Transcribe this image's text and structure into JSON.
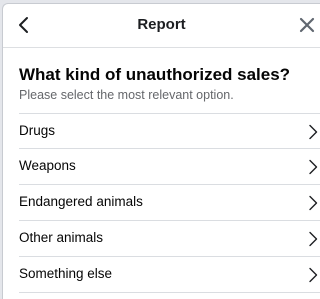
{
  "header": {
    "title": "Report",
    "back_icon": "chevron-left-icon",
    "close_icon": "close-icon"
  },
  "question": {
    "title": "What kind of unauthorized sales?",
    "subtitle": "Please select the most relevant option."
  },
  "options": [
    {
      "label": "Drugs",
      "icon": "chevron-right-icon"
    },
    {
      "label": "Weapons",
      "icon": "chevron-right-icon"
    },
    {
      "label": "Endangered animals",
      "icon": "chevron-right-icon"
    },
    {
      "label": "Other animals",
      "icon": "chevron-right-icon"
    },
    {
      "label": "Something else",
      "icon": "chevron-right-icon"
    }
  ],
  "colors": {
    "text_primary": "#050505",
    "text_secondary": "#65676b",
    "divider": "#dadde1",
    "background": "#e4e6eb"
  }
}
